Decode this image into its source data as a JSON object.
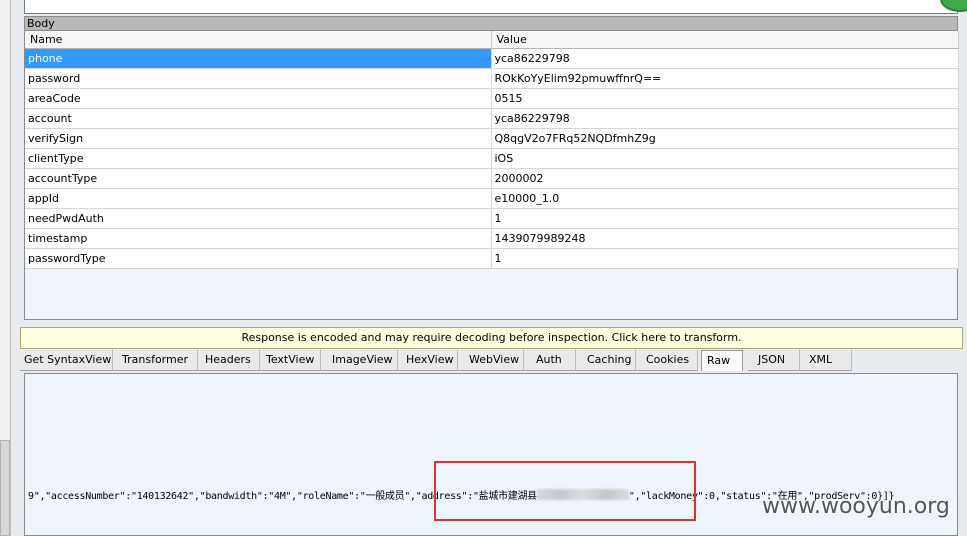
{
  "body_section": {
    "title": "Body",
    "columns": [
      "Name",
      "Value"
    ],
    "rows": [
      {
        "name": "phone",
        "value": "yca86229798"
      },
      {
        "name": "password",
        "value": "ROkKoYyElim92pmuwffnrQ=="
      },
      {
        "name": "areaCode",
        "value": "0515"
      },
      {
        "name": "account",
        "value": "yca86229798"
      },
      {
        "name": "verifySign",
        "value": "Q8qgV2o7FRq52NQDfmhZ9g"
      },
      {
        "name": "clientType",
        "value": "iOS"
      },
      {
        "name": "accountType",
        "value": "2000002"
      },
      {
        "name": "appId",
        "value": "e10000_1.0"
      },
      {
        "name": "needPwdAuth",
        "value": "1"
      },
      {
        "name": "timestamp",
        "value": "1439079989248"
      },
      {
        "name": "passwordType",
        "value": "1"
      }
    ],
    "selected_row": "phone"
  },
  "response": {
    "banner": "Response is encoded and may require decoding before inspection. Click here to transform.",
    "tabs": [
      "Get SyntaxView",
      "Transformer",
      "Headers",
      "TextView",
      "ImageView",
      "HexView",
      "WebView",
      "Auth",
      "Caching",
      "Cookies",
      "Raw",
      "JSON",
      "XML"
    ],
    "active_tab": "Raw",
    "raw_text_before": "9\",\"accessNumber\":\"140132642\",\"bandwidth\":\"4M\",\"roleName\":\"一般成员\",\"address\":\"盐城市建湖县",
    "raw_text_after": "\",\"lackMoney\":0,\"status\":\"在用\",\"prodServ\":0}]}"
  },
  "watermark": "www.wooyun.org",
  "colors": {
    "selection": "#3399ff",
    "highlight_border": "#e03030",
    "banner_bg": "#ffffe1"
  }
}
